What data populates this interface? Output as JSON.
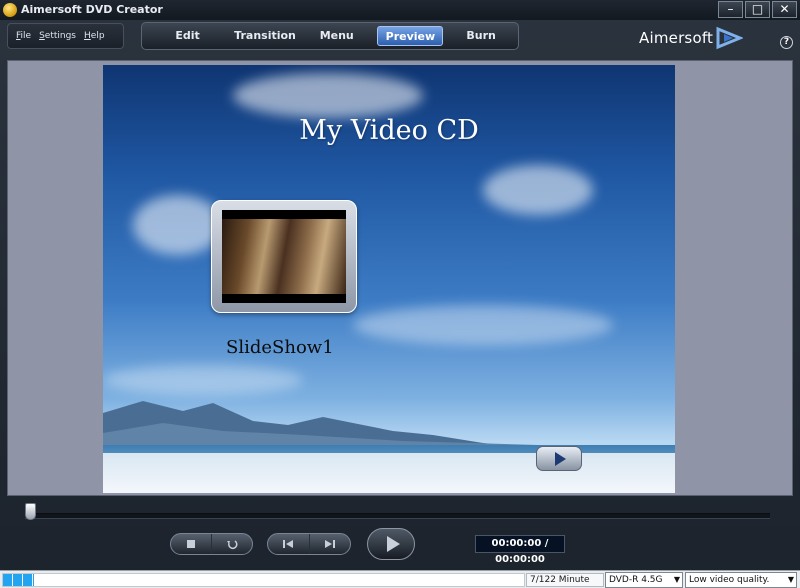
{
  "window": {
    "title": "Aimersoft DVD Creator",
    "minimize_glyph": "–",
    "maximize_glyph": "□",
    "close_glyph": "✕"
  },
  "menu": {
    "file": "File",
    "settings": "Settings",
    "help": "Help"
  },
  "tabs": [
    {
      "label": "Edit",
      "active": false
    },
    {
      "label": "Transition",
      "active": false
    },
    {
      "label": "Menu",
      "active": false
    },
    {
      "label": "Preview",
      "active": true
    },
    {
      "label": "Burn",
      "active": false
    }
  ],
  "brand": {
    "logo_text": "Aimersoft",
    "help_glyph": "?",
    "accent": "#3a73c9"
  },
  "preview": {
    "menu_title": "My Video CD",
    "item_label": "SlideShow1"
  },
  "player": {
    "timeline_progress": 0,
    "time_readout": "00:00:00 / 00:00:00",
    "controls": [
      "stop-icon",
      "rewind-icon",
      "previous-icon",
      "next-icon",
      "play-icon"
    ]
  },
  "status": {
    "capacity_used_fraction": 0.06,
    "duration": "7/122 Minute",
    "disc_type": "DVD-R 4.5G",
    "quality": "Low video quality."
  }
}
